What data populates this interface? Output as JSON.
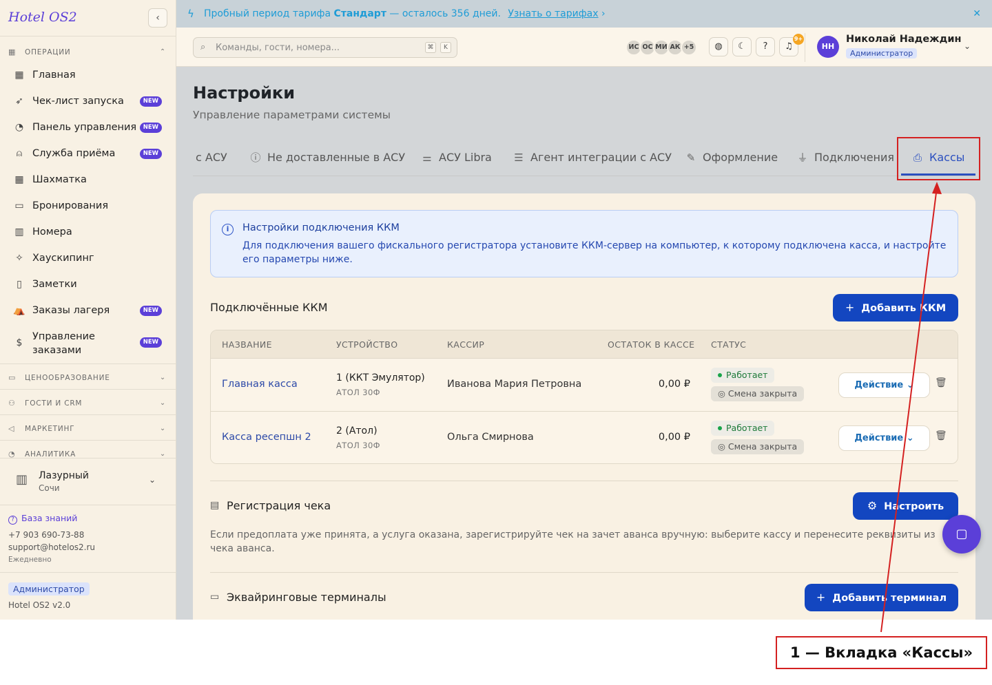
{
  "sidebar": {
    "logo": "Hotel OS2",
    "collapse_icon": "chevron-left-icon",
    "sections": {
      "operations": "ОПЕРАЦИИ",
      "pricing": "ЦЕНООБРАЗОВАНИЕ",
      "guests": "ГОСТИ И CRM",
      "marketing": "МАРКЕТИНГ",
      "analytics": "АНАЛИТИКА"
    },
    "items": [
      {
        "label": "Главная",
        "icon": "dashboard-icon",
        "badge": ""
      },
      {
        "label": "Чек-лист запуска",
        "icon": "rocket-icon",
        "badge": "NEW"
      },
      {
        "label": "Панель управления",
        "icon": "gauge-icon",
        "badge": "NEW"
      },
      {
        "label": "Служба приёма",
        "icon": "bell-icon",
        "badge": "NEW"
      },
      {
        "label": "Шахматка",
        "icon": "grid-icon",
        "badge": ""
      },
      {
        "label": "Бронирования",
        "icon": "clipboard-icon",
        "badge": ""
      },
      {
        "label": "Номера",
        "icon": "building-icon",
        "badge": ""
      },
      {
        "label": "Хаускипинг",
        "icon": "sparkle-icon",
        "badge": ""
      },
      {
        "label": "Заметки",
        "icon": "note-icon",
        "badge": ""
      },
      {
        "label": "Заказы лагеря",
        "icon": "tent-icon",
        "badge": "NEW"
      },
      {
        "label": "Управление заказами",
        "icon": "receipt-icon",
        "badge": "NEW"
      }
    ],
    "hotel": {
      "name": "Лазурный",
      "city": "Сочи"
    },
    "support": {
      "kb": "База знаний",
      "phone": "+7 903 690-73-88",
      "email": "support@hotelos2.ru",
      "hours": "Ежедневно"
    },
    "role": "Администратор",
    "version": "Hotel OS2 v2.0"
  },
  "banner": {
    "prefix": "Пробный период тарифа",
    "plan": "Стандарт",
    "suffix": "— осталось 356 дней.",
    "link": "Узнать о тарифах",
    "link_arrow": "›",
    "close": "✕"
  },
  "header": {
    "search_placeholder": "Команды, гости, номера...",
    "kbd1": "⌘",
    "kbd2": "K",
    "avatars": [
      "ИС",
      "ОС",
      "МИ",
      "АК",
      "+5"
    ],
    "notif_badge": "9+",
    "user_initials": "НН",
    "user_name": "Николай Надеждин",
    "user_role": "Администратор"
  },
  "page": {
    "title": "Настройки",
    "subtitle": "Управление параметрами системы"
  },
  "tabs": [
    {
      "label": "с АСУ",
      "icon": ""
    },
    {
      "label": "Не доставленные в АСУ",
      "icon": "alert-circle-icon"
    },
    {
      "label": "АСУ Libra",
      "icon": "sliders-icon"
    },
    {
      "label": "Агент интеграции с АСУ",
      "icon": "server-icon"
    },
    {
      "label": "Оформление",
      "icon": "pencil-icon"
    },
    {
      "label": "Подключения",
      "icon": "plug-icon"
    },
    {
      "label": "Кассы",
      "icon": "printer-icon",
      "active": true
    }
  ],
  "info": {
    "title": "Настройки подключения ККМ",
    "text": "Для подключения вашего фискального регистратора установите ККМ-сервер на компьютер, к которому подключена касса, и настройте его параметры ниже."
  },
  "kkm": {
    "title": "Подключённые ККМ",
    "add_button": "Добавить ККМ",
    "columns": [
      "НАЗВАНИЕ",
      "УСТРОЙСТВО",
      "КАССИР",
      "ОСТАТОК В КАССЕ",
      "СТАТУС"
    ],
    "rows": [
      {
        "name": "Главная касса",
        "device": "1 (ККТ Эмулятор)",
        "device_model": "АТОЛ 30Ф",
        "cashier": "Иванова Мария Петровна",
        "balance": "0,00 ₽",
        "status": "Работает",
        "shift": "Смена закрыта",
        "action": "Действие"
      },
      {
        "name": "Касса ресепшн 2",
        "device": "2 (Атол)",
        "device_model": "АТОЛ 30Ф",
        "cashier": "Ольга Смирнова",
        "balance": "0,00 ₽",
        "status": "Работает",
        "shift": "Смена закрыта",
        "action": "Действие"
      }
    ]
  },
  "receipt": {
    "title": "Регистрация чека",
    "button": "Настроить",
    "text": "Если предоплата уже принята, а услуга оказана, зарегистрируйте чек на зачет аванса вручную: выберите кассу и перенесите реквизиты из чека аванса."
  },
  "terminals": {
    "title": "Эквайринговые терминалы",
    "button": "Добавить терминал"
  },
  "annotation": {
    "label": "1 — Вкладка «Кассы»",
    "color": "#d42020"
  },
  "colors": {
    "accent": "#5b3fd8",
    "primary": "#1346c0",
    "link": "#2d4aa8",
    "success": "#19a44a"
  }
}
